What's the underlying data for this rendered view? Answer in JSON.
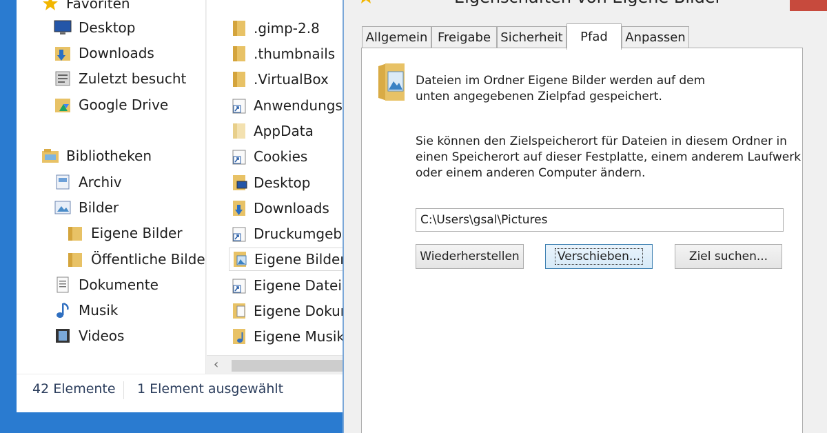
{
  "explorer": {
    "nav": {
      "favorites": "Favoriten",
      "items": [
        {
          "label": "Desktop",
          "icon": "desktop-icon"
        },
        {
          "label": "Downloads",
          "icon": "downloads-folder-icon"
        },
        {
          "label": "Zuletzt besucht",
          "icon": "recent-places-icon"
        },
        {
          "label": "Google Drive",
          "icon": "google-drive-icon"
        }
      ],
      "libraries": "Bibliotheken",
      "library_items": [
        {
          "label": "Archiv",
          "icon": "library-icon"
        },
        {
          "label": "Bilder",
          "icon": "pictures-library-icon"
        },
        {
          "label": "Eigene Bilder",
          "icon": "folder-icon"
        },
        {
          "label": "Öffentliche Bilder",
          "icon": "folder-icon"
        },
        {
          "label": "Dokumente",
          "icon": "documents-icon"
        },
        {
          "label": "Musik",
          "icon": "music-icon"
        },
        {
          "label": "Videos",
          "icon": "videos-icon"
        }
      ]
    },
    "files": [
      {
        "label": ".gimp-2.8",
        "icon": "folder-icon"
      },
      {
        "label": ".thumbnails",
        "icon": "folder-icon"
      },
      {
        "label": ".VirtualBox",
        "icon": "folder-icon"
      },
      {
        "label": "Anwendungsdaten",
        "icon": "shortcut-icon"
      },
      {
        "label": "AppData",
        "icon": "hidden-folder-icon"
      },
      {
        "label": "Cookies",
        "icon": "shortcut-icon"
      },
      {
        "label": "Desktop",
        "icon": "desktop-folder-icon"
      },
      {
        "label": "Downloads",
        "icon": "downloads-folder-icon"
      },
      {
        "label": "Druckumgebung",
        "icon": "shortcut-icon"
      },
      {
        "label": "Eigene Bilder",
        "icon": "pictures-folder-icon",
        "selected": true
      },
      {
        "label": "Eigene Dateien",
        "icon": "shortcut-icon"
      },
      {
        "label": "Eigene Dokumente",
        "icon": "documents-folder-icon"
      },
      {
        "label": "Eigene Musik",
        "icon": "music-folder-icon"
      }
    ],
    "status": {
      "count": "42 Elemente",
      "selection": "1 Element ausgewählt"
    }
  },
  "dialog": {
    "title": "Eigenschaften von Eigene Bilder",
    "tabs": [
      "Allgemein",
      "Freigabe",
      "Sicherheit",
      "Pfad",
      "Anpassen"
    ],
    "active_tab": "Pfad",
    "desc1_line1": "Dateien im Ordner Eigene Bilder werden auf dem",
    "desc1_line2": "unten angegebenen Zielpfad gespeichert.",
    "desc2_line1": "Sie können den Zielspeicherort für Dateien in diesem Ordner in",
    "desc2_line2": "einen Speicherort auf dieser Festplatte, einem anderem Laufwerk",
    "desc2_line3": "oder einem anderen Computer ändern.",
    "path_value": "C:\\Users\\gsal\\Pictures",
    "buttons": {
      "restore": "Wiederherstellen",
      "move": "Verschieben...",
      "find_target": "Ziel suchen..."
    }
  },
  "colors": {
    "desktop_blue": "#2a7bd0",
    "folder_yellow": "#e8c266",
    "focus_border": "#3c7fb1"
  }
}
